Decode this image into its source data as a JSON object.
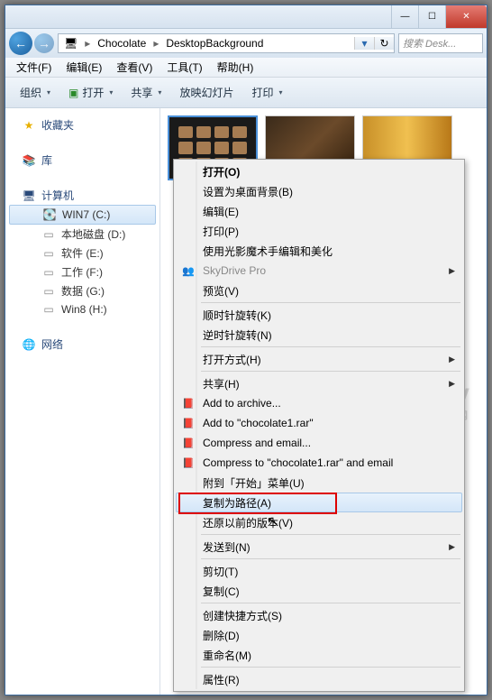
{
  "titlebar": {
    "min": "—",
    "max": "☐",
    "close": "✕"
  },
  "nav": {
    "back": "←",
    "fwd": "→"
  },
  "breadcrumb": {
    "icon": "🖥",
    "seg1": "Chocolate",
    "seg2": "DesktopBackground",
    "refresh": "↻"
  },
  "search": {
    "placeholder": "搜索 Desk..."
  },
  "menubar": {
    "file": "文件(F)",
    "edit": "编辑(E)",
    "view": "查看(V)",
    "tools": "工具(T)",
    "help": "帮助(H)"
  },
  "toolbar": {
    "organize": "组织",
    "open": "打开",
    "share": "共享",
    "slideshow": "放映幻灯片",
    "print": "打印"
  },
  "sidebar": {
    "favorites": {
      "label": "收藏夹",
      "icon": "★"
    },
    "library": {
      "label": "库",
      "icon": "📚"
    },
    "computer": {
      "label": "计算机",
      "icon": "🖥",
      "drives": [
        {
          "label": "WIN7 (C:)",
          "icon": "💽",
          "selected": true
        },
        {
          "label": "本地磁盘 (D:)",
          "icon": "▭"
        },
        {
          "label": "软件 (E:)",
          "icon": "▭"
        },
        {
          "label": "工作 (F:)",
          "icon": "▭"
        },
        {
          "label": "数据 (G:)",
          "icon": "▭"
        },
        {
          "label": "Win8 (H:)",
          "icon": "▭"
        }
      ]
    },
    "network": {
      "label": "网络",
      "icon": "🌐"
    }
  },
  "contextmenu": {
    "items": [
      {
        "label": "打开(O)",
        "bold": true
      },
      {
        "label": "设置为桌面背景(B)"
      },
      {
        "label": "编辑(E)"
      },
      {
        "label": "打印(P)"
      },
      {
        "label": "使用光影魔术手编辑和美化"
      },
      {
        "label": "SkyDrive Pro",
        "disabled": true,
        "arrow": true,
        "icon": "👥"
      },
      {
        "label": "预览(V)"
      },
      {
        "sep": true
      },
      {
        "label": "顺时针旋转(K)"
      },
      {
        "label": "逆时针旋转(N)"
      },
      {
        "sep": true
      },
      {
        "label": "打开方式(H)",
        "arrow": true
      },
      {
        "sep": true
      },
      {
        "label": "共享(H)",
        "arrow": true
      },
      {
        "label": "Add to archive...",
        "icon": "📕"
      },
      {
        "label": "Add to \"chocolate1.rar\"",
        "icon": "📕"
      },
      {
        "label": "Compress and email...",
        "icon": "📕"
      },
      {
        "label": "Compress to \"chocolate1.rar\" and email",
        "icon": "📕"
      },
      {
        "label": "附到「开始」菜单(U)"
      },
      {
        "label": "复制为路径(A)",
        "hover": true
      },
      {
        "label": "还原以前的版本(V)"
      },
      {
        "sep": true
      },
      {
        "label": "发送到(N)",
        "arrow": true
      },
      {
        "sep": true
      },
      {
        "label": "剪切(T)"
      },
      {
        "label": "复制(C)"
      },
      {
        "sep": true
      },
      {
        "label": "创建快捷方式(S)"
      },
      {
        "label": "删除(D)"
      },
      {
        "label": "重命名(M)"
      },
      {
        "sep": true
      },
      {
        "label": "属性(R)"
      }
    ]
  },
  "watermark": {
    "brand": "yësky",
    "sub": "天 极 网"
  }
}
